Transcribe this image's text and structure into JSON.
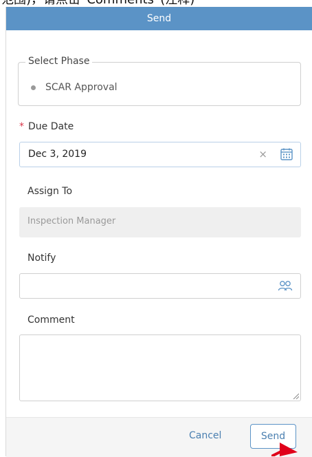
{
  "top_strip_text": "范围)，请点击“Comments”(注释)",
  "dialog": {
    "title": "Send",
    "select_phase": {
      "legend": "Select Phase",
      "value": "SCAR Approval"
    },
    "due_date": {
      "required_mark": "*",
      "label": "Due Date",
      "value": "Dec 3, 2019",
      "clear_symbol": "×"
    },
    "assign_to": {
      "label": "Assign To",
      "value": "Inspection Manager"
    },
    "notify": {
      "label": "Notify",
      "value": ""
    },
    "comment": {
      "label": "Comment",
      "value": ""
    },
    "footer": {
      "cancel_label": "Cancel",
      "send_label": "Send"
    }
  },
  "colors": {
    "header_bg": "#5b93c6",
    "required": "#d9364a",
    "link": "#4a7fb0",
    "annotation_arrow": "#e0001a"
  },
  "icons": {
    "date_clear": "close-icon",
    "date_picker": "calendar-icon",
    "notify_picker": "people-icon",
    "phase_status": "dot-icon"
  }
}
